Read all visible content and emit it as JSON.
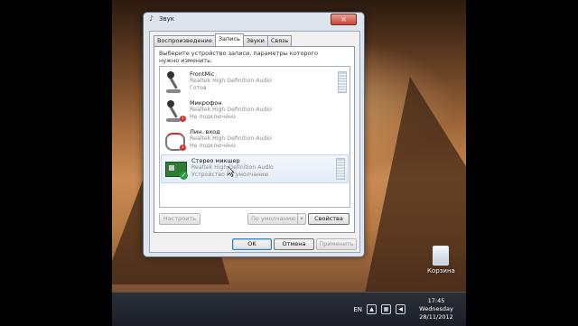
{
  "dialog": {
    "title": "Звук",
    "close_label": "×",
    "tabs": [
      {
        "label": "Воспроизведение",
        "active": false
      },
      {
        "label": "Запись",
        "active": true
      },
      {
        "label": "Звуки",
        "active": false
      },
      {
        "label": "Связь",
        "active": false
      }
    ],
    "instruction": "Выберите устройство записи, параметры которого нужно изменить:",
    "devices": [
      {
        "name": "FrontMic",
        "driver": "Realtek High Definition Audio",
        "status": "Готов",
        "icon": "microphone-icon",
        "badge": ""
      },
      {
        "name": "Микрофон",
        "driver": "Realtek High Definition Audio",
        "status": "Не подключено",
        "icon": "microphone-icon",
        "badge": "not-connected"
      },
      {
        "name": "Лин. вход",
        "driver": "Realtek High Definition Audio",
        "status": "Не подключено",
        "icon": "line-in-icon",
        "badge": "not-connected"
      },
      {
        "name": "Стерео микшер",
        "driver": "Realtek High Definition Audio",
        "status": "Устройство по умолчанию",
        "icon": "sound-card-icon",
        "badge": "default"
      }
    ],
    "buttons": {
      "configure": "Настроить",
      "set_default": "По умолчанию",
      "properties": "Свойства",
      "ok": "OK",
      "cancel": "Отмена",
      "apply": "Применить"
    }
  },
  "desktop": {
    "recycle_bin_label": "Корзина"
  },
  "taskbar": {
    "language": "EN",
    "time": "17:45",
    "day": "Wednesday",
    "date": "28/11/2012"
  },
  "colors": {
    "accent": "#3c7fb1",
    "ok_badge": "#2e9c3a",
    "error_badge": "#d32f2f"
  }
}
